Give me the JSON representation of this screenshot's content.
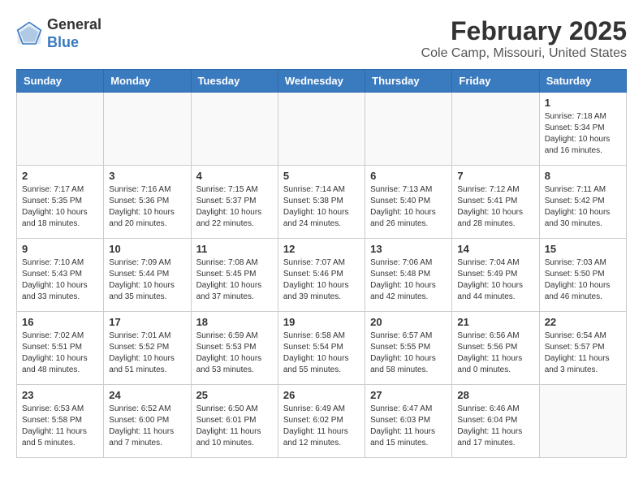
{
  "header": {
    "logo_line1": "General",
    "logo_line2": "Blue",
    "title": "February 2025",
    "subtitle": "Cole Camp, Missouri, United States"
  },
  "weekdays": [
    "Sunday",
    "Monday",
    "Tuesday",
    "Wednesday",
    "Thursday",
    "Friday",
    "Saturday"
  ],
  "weeks": [
    [
      {
        "day": "",
        "info": ""
      },
      {
        "day": "",
        "info": ""
      },
      {
        "day": "",
        "info": ""
      },
      {
        "day": "",
        "info": ""
      },
      {
        "day": "",
        "info": ""
      },
      {
        "day": "",
        "info": ""
      },
      {
        "day": "1",
        "info": "Sunrise: 7:18 AM\nSunset: 5:34 PM\nDaylight: 10 hours\nand 16 minutes."
      }
    ],
    [
      {
        "day": "2",
        "info": "Sunrise: 7:17 AM\nSunset: 5:35 PM\nDaylight: 10 hours\nand 18 minutes."
      },
      {
        "day": "3",
        "info": "Sunrise: 7:16 AM\nSunset: 5:36 PM\nDaylight: 10 hours\nand 20 minutes."
      },
      {
        "day": "4",
        "info": "Sunrise: 7:15 AM\nSunset: 5:37 PM\nDaylight: 10 hours\nand 22 minutes."
      },
      {
        "day": "5",
        "info": "Sunrise: 7:14 AM\nSunset: 5:38 PM\nDaylight: 10 hours\nand 24 minutes."
      },
      {
        "day": "6",
        "info": "Sunrise: 7:13 AM\nSunset: 5:40 PM\nDaylight: 10 hours\nand 26 minutes."
      },
      {
        "day": "7",
        "info": "Sunrise: 7:12 AM\nSunset: 5:41 PM\nDaylight: 10 hours\nand 28 minutes."
      },
      {
        "day": "8",
        "info": "Sunrise: 7:11 AM\nSunset: 5:42 PM\nDaylight: 10 hours\nand 30 minutes."
      }
    ],
    [
      {
        "day": "9",
        "info": "Sunrise: 7:10 AM\nSunset: 5:43 PM\nDaylight: 10 hours\nand 33 minutes."
      },
      {
        "day": "10",
        "info": "Sunrise: 7:09 AM\nSunset: 5:44 PM\nDaylight: 10 hours\nand 35 minutes."
      },
      {
        "day": "11",
        "info": "Sunrise: 7:08 AM\nSunset: 5:45 PM\nDaylight: 10 hours\nand 37 minutes."
      },
      {
        "day": "12",
        "info": "Sunrise: 7:07 AM\nSunset: 5:46 PM\nDaylight: 10 hours\nand 39 minutes."
      },
      {
        "day": "13",
        "info": "Sunrise: 7:06 AM\nSunset: 5:48 PM\nDaylight: 10 hours\nand 42 minutes."
      },
      {
        "day": "14",
        "info": "Sunrise: 7:04 AM\nSunset: 5:49 PM\nDaylight: 10 hours\nand 44 minutes."
      },
      {
        "day": "15",
        "info": "Sunrise: 7:03 AM\nSunset: 5:50 PM\nDaylight: 10 hours\nand 46 minutes."
      }
    ],
    [
      {
        "day": "16",
        "info": "Sunrise: 7:02 AM\nSunset: 5:51 PM\nDaylight: 10 hours\nand 48 minutes."
      },
      {
        "day": "17",
        "info": "Sunrise: 7:01 AM\nSunset: 5:52 PM\nDaylight: 10 hours\nand 51 minutes."
      },
      {
        "day": "18",
        "info": "Sunrise: 6:59 AM\nSunset: 5:53 PM\nDaylight: 10 hours\nand 53 minutes."
      },
      {
        "day": "19",
        "info": "Sunrise: 6:58 AM\nSunset: 5:54 PM\nDaylight: 10 hours\nand 55 minutes."
      },
      {
        "day": "20",
        "info": "Sunrise: 6:57 AM\nSunset: 5:55 PM\nDaylight: 10 hours\nand 58 minutes."
      },
      {
        "day": "21",
        "info": "Sunrise: 6:56 AM\nSunset: 5:56 PM\nDaylight: 11 hours\nand 0 minutes."
      },
      {
        "day": "22",
        "info": "Sunrise: 6:54 AM\nSunset: 5:57 PM\nDaylight: 11 hours\nand 3 minutes."
      }
    ],
    [
      {
        "day": "23",
        "info": "Sunrise: 6:53 AM\nSunset: 5:58 PM\nDaylight: 11 hours\nand 5 minutes."
      },
      {
        "day": "24",
        "info": "Sunrise: 6:52 AM\nSunset: 6:00 PM\nDaylight: 11 hours\nand 7 minutes."
      },
      {
        "day": "25",
        "info": "Sunrise: 6:50 AM\nSunset: 6:01 PM\nDaylight: 11 hours\nand 10 minutes."
      },
      {
        "day": "26",
        "info": "Sunrise: 6:49 AM\nSunset: 6:02 PM\nDaylight: 11 hours\nand 12 minutes."
      },
      {
        "day": "27",
        "info": "Sunrise: 6:47 AM\nSunset: 6:03 PM\nDaylight: 11 hours\nand 15 minutes."
      },
      {
        "day": "28",
        "info": "Sunrise: 6:46 AM\nSunset: 6:04 PM\nDaylight: 11 hours\nand 17 minutes."
      },
      {
        "day": "",
        "info": ""
      }
    ]
  ]
}
